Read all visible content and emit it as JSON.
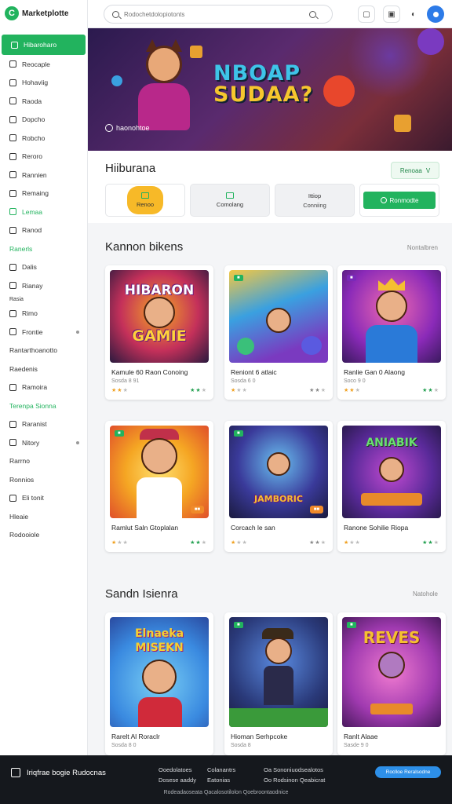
{
  "brand": {
    "logo": "C",
    "name": "Marketplotte"
  },
  "sidebar": {
    "items": [
      {
        "label": "Hibaroharo",
        "icon": "home-icon"
      },
      {
        "label": "Reocaple",
        "icon": "grid-icon"
      },
      {
        "label": "Hohaviig",
        "icon": "game-icon"
      },
      {
        "label": "Raoda",
        "icon": "bag-icon"
      },
      {
        "label": "Dopcho",
        "icon": "people-icon"
      },
      {
        "label": "Robcho",
        "icon": "chart-icon"
      },
      {
        "label": "Reroro",
        "icon": "star-icon"
      },
      {
        "label": "Rannien",
        "icon": "award-icon"
      },
      {
        "label": "Remaing",
        "icon": "folder-icon"
      },
      {
        "label": "Lemaa",
        "icon": "green-icon"
      },
      {
        "label": "Ranod",
        "icon": "doc-icon"
      },
      {
        "label": "Ranerls"
      },
      {
        "label": "Dalis",
        "icon": "list-icon"
      },
      {
        "label": "Rianay",
        "icon": "mail-icon"
      },
      {
        "label": "Rasia"
      },
      {
        "label": "Rimo",
        "icon": "box-icon"
      },
      {
        "label": "Frontie",
        "icon": "book-icon"
      },
      {
        "label": "Rantarthoanotto"
      },
      {
        "label": "Raedenis"
      },
      {
        "label": "Ramoira",
        "icon": "cart-icon"
      },
      {
        "label": "Terenpa Sionna"
      },
      {
        "label": "Raranist",
        "icon": "tag-icon"
      },
      {
        "label": "Nitory",
        "icon": "clock-icon"
      },
      {
        "label": "Rarrno"
      },
      {
        "label": "Ronnios"
      },
      {
        "label": "Eli tonit",
        "icon": "flag-icon"
      },
      {
        "label": "Hleaie"
      },
      {
        "label": "Rodooiole"
      }
    ]
  },
  "search": {
    "placeholder": "Rodochetdolopiotonts"
  },
  "hero": {
    "title_line1": "NBOAP",
    "title_line2": "SUDAA?",
    "caption": "haonohtoe"
  },
  "panel": {
    "title": "Hiiburana",
    "filter_label": "Renoaa",
    "filter_chevron": "V",
    "tabs": [
      {
        "label": "Renoo"
      },
      {
        "label": "Comolang"
      },
      {
        "label": "Ittiop",
        "sub": "Conniing"
      },
      {
        "label": "Ronmodte"
      }
    ]
  },
  "sections": [
    {
      "title": "Kannon bikens",
      "more": "Nontalbren",
      "cards": [
        {
          "art": "HIBARON GAMIE",
          "title": "Kamule 60 Raon Conoing",
          "sub": "Sosda 8 91"
        },
        {
          "art": "",
          "title": "Reniont 6 atlaic",
          "sub": "Sosda 6 0"
        },
        {
          "art": "",
          "title": "Ranlie Gan 0 Alaong",
          "sub": "Soco 9 0"
        },
        {
          "art": "",
          "title": "Ramlut Saln Gtoplalan",
          "sub": ""
        },
        {
          "art": "JAMBORIC",
          "title": "Corcach le san",
          "sub": ""
        },
        {
          "art": "ANIABIK",
          "title": "Ranone Sohilie Riopa",
          "sub": ""
        }
      ]
    },
    {
      "title": "Sandn Isienra",
      "more": "Natohole",
      "cards": [
        {
          "art": "Elnaeka MISEKN",
          "title": "Rarelt Al Roraclr",
          "sub": "Sosda 8 0"
        },
        {
          "art": "",
          "title": "Hioman Serhpcoke",
          "sub": "Sosda 8"
        },
        {
          "art": "REVES",
          "title": "Ranlt Alaae",
          "sub": "Sasde 9 0"
        }
      ]
    }
  ],
  "footer": {
    "brand": "Iriqfrae bogie Rudocnas",
    "col1": [
      "Ooedolatoes",
      "Dosese aaddy"
    ],
    "col2": [
      "Colanantrs",
      "Eatonias"
    ],
    "col3": [
      "Oa Sononiuodsealotos",
      "Oo Rodsinon Qeabicrat"
    ],
    "cta": "Roclloe Reralsodne",
    "bottom": "Rodeadaoseata Qacalosotilolon Qoebroontaodnice"
  }
}
